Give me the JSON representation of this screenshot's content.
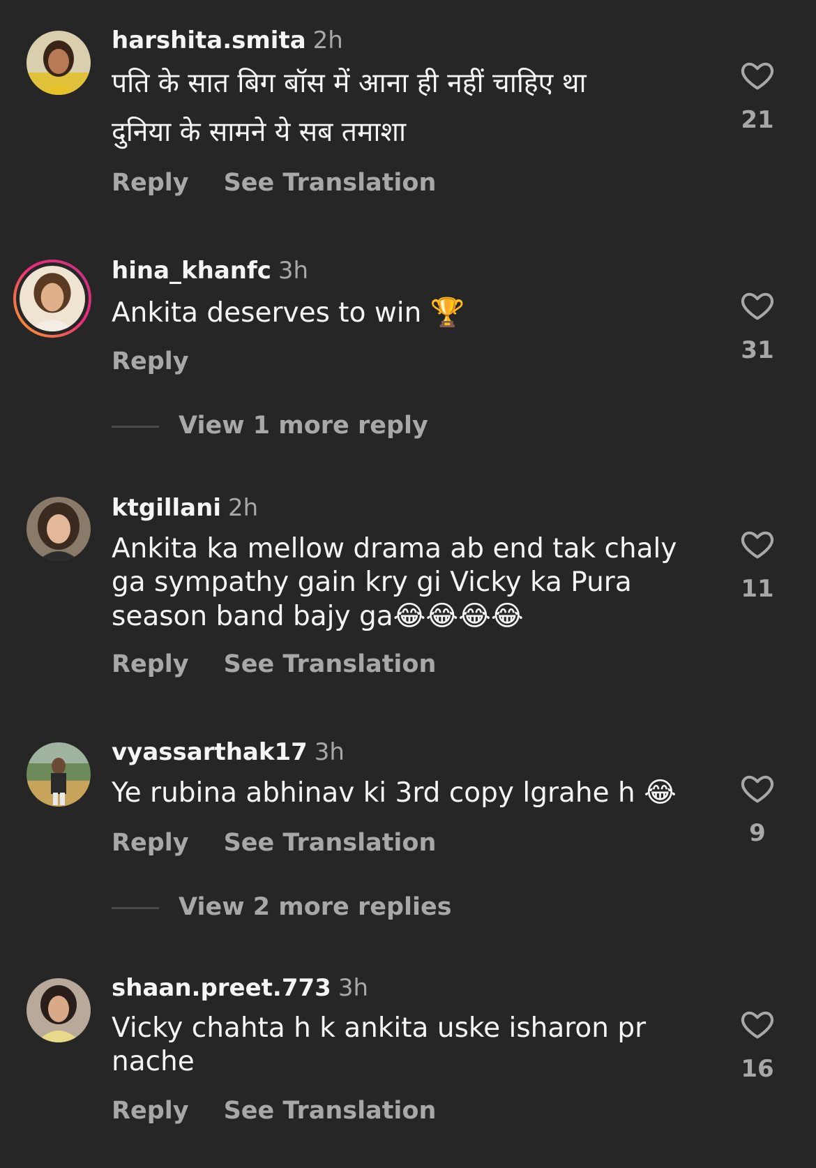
{
  "comments": [
    {
      "username": "harshita.smita",
      "time": "2h",
      "text_line1": "पति के सात बिग बॉस में आना ही नहीं चाहिए था",
      "text_line2": "दुनिया के सामने ये सब तमाशा",
      "reply_label": "Reply",
      "translate_label": "See Translation",
      "likes": "21"
    },
    {
      "username": "hina_khanfc",
      "time": "3h",
      "text": "Ankita deserves to win",
      "emoji": "🏆",
      "reply_label": "Reply",
      "likes": "31",
      "more_replies": "View 1 more reply"
    },
    {
      "username": "ktgillani",
      "time": "2h",
      "text": "Ankita ka mellow drama ab end tak chaly ga sympathy gain kry gi Vicky ka Pura season band bajy ga",
      "emoji": "😂😂😂😂",
      "reply_label": "Reply",
      "translate_label": "See Translation",
      "likes": "11"
    },
    {
      "username": "vyassarthak17",
      "time": "3h",
      "text": "Ye rubina abhinav ki 3rd copy lgrahe h",
      "emoji": "😂",
      "reply_label": "Reply",
      "translate_label": "See Translation",
      "likes": "9",
      "more_replies": "View 2 more replies"
    },
    {
      "username": "shaan.preet.773",
      "time": "3h",
      "text": "Vicky chahta h k ankita uske isharon pr nache",
      "reply_label": "Reply",
      "translate_label": "See Translation",
      "likes": "16"
    }
  ],
  "icons": {
    "like": "heart-outline-icon"
  },
  "colors": {
    "background": "#262626",
    "primary_text": "#f5f5f5",
    "secondary_text": "#a8a8a8"
  }
}
